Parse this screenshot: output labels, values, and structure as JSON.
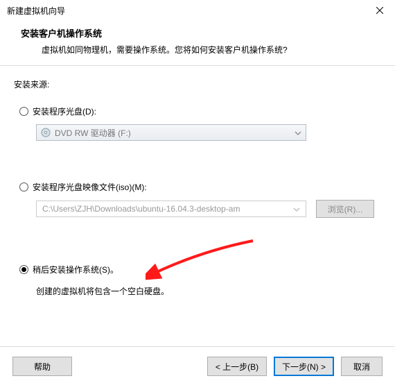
{
  "titlebar": {
    "title": "新建虚拟机向导"
  },
  "header": {
    "title": "安装客户机操作系统",
    "subtitle": "虚拟机如同物理机，需要操作系统。您将如何安装客户机操作系统?"
  },
  "source_label": "安装来源:",
  "option_disc": {
    "label": "安装程序光盘(D):",
    "dropdown_text": "DVD RW 驱动器 (F:)"
  },
  "option_iso": {
    "label": "安装程序光盘映像文件(iso)(M):",
    "path": "C:\\Users\\ZJH\\Downloads\\ubuntu-16.04.3-desktop-am",
    "browse": "浏览(R)..."
  },
  "option_later": {
    "label": "稍后安装操作系统(S)。",
    "hint": "创建的虚拟机将包含一个空白硬盘。"
  },
  "footer": {
    "help": "帮助",
    "back": "< 上一步(B)",
    "next": "下一步(N) >",
    "cancel": "取消"
  }
}
